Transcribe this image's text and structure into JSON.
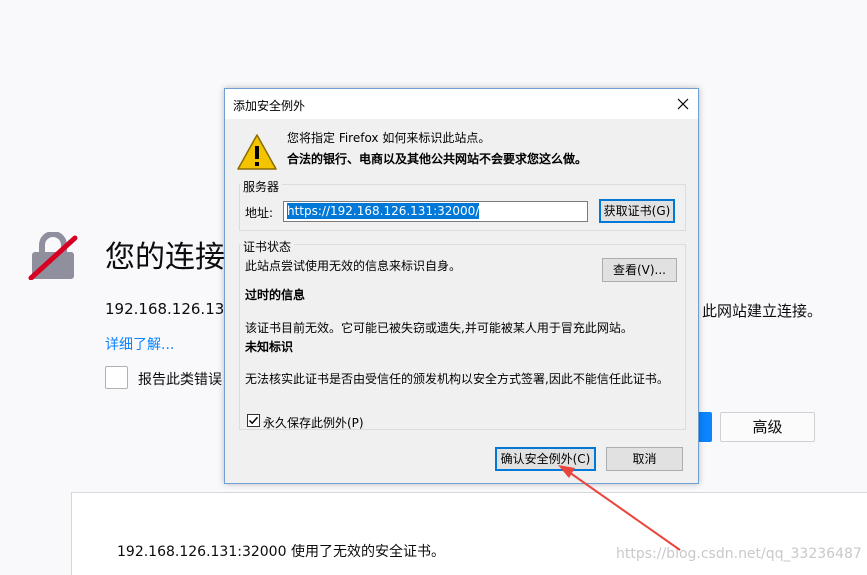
{
  "background": {
    "title": "您的连接",
    "desc_left": "192.168.126.131",
    "desc_right": "此网站建立连接。",
    "learn_more": "详细了解...",
    "report_label": "报告此类错误",
    "advanced_button": "高级",
    "panel_text": "192.168.126.131:32000 使用了无效的安全证书。",
    "watermark": "https://blog.csdn.net/qq_33236487"
  },
  "dialog": {
    "title": "添加安全例外",
    "warning_line1": "您将指定 Firefox 如何来标识此站点。",
    "warning_line2": "合法的银行、电商以及其他公共网站不会要求您这么做。",
    "server": {
      "label": "服务器",
      "address_label": "地址:",
      "address_value": "https://192.168.126.131:32000/",
      "get_cert_button": "获取证书(G)"
    },
    "status": {
      "label": "证书状态",
      "text": "此站点尝试使用无效的信息来标识自身。",
      "view_button": "查看(V)...",
      "outdated_heading": "过时的信息",
      "outdated_text": "该证书目前无效。它可能已被失窃或遗失,并可能被某人用于冒充此网站。",
      "unknown_heading": "未知标识",
      "unknown_text": "无法核实此证书是否由受信任的颁发机构以安全方式签署,因此不能信任此证书。"
    },
    "permanent_label": "永久保存此例外(P)",
    "permanent_checked": true,
    "confirm_button": "确认安全例外(C)",
    "cancel_button": "取消"
  },
  "colors": {
    "accent": "#0078d7",
    "link": "#0a84ff",
    "arrow": "#e8453c"
  }
}
